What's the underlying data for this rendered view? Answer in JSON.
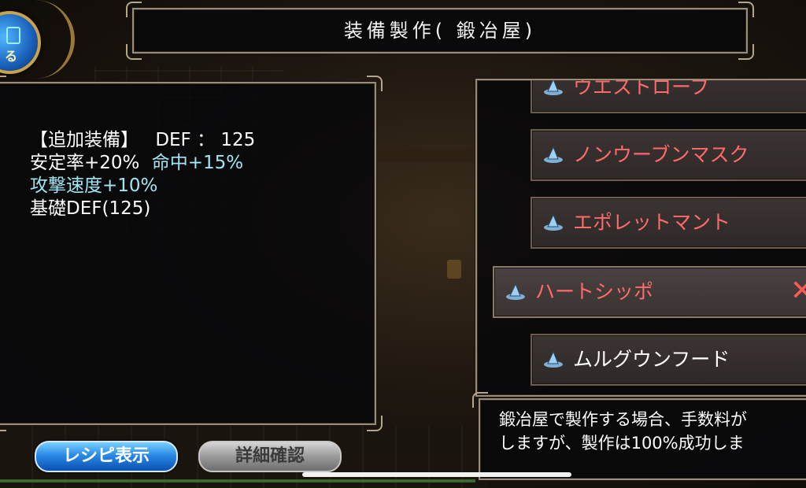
{
  "header": {
    "title": "装備製作( 鍛冶屋)"
  },
  "corner_button": {
    "label": "る"
  },
  "stats": {
    "line1_label": "【追加装備】",
    "line1_value": "DEF ： 125",
    "line2_a": "安定率+20%",
    "line2_b": "命中+15%",
    "line3": "攻撃速度+10%",
    "line4": "基礎DEF(125)"
  },
  "items": [
    {
      "label": "ウエストローブ"
    },
    {
      "label": "ノンウーブンマスク"
    },
    {
      "label": "エポレットマント"
    },
    {
      "label": "ハートシッポ",
      "close": "✕"
    },
    {
      "label": "ムルグウンフード"
    }
  ],
  "description": {
    "line1": "鍛冶屋で製作する場合、手数料が",
    "line2": "しますが、製作は100%成功しま"
  },
  "buttons": {
    "recipe": "レシピ表示",
    "detail": "詳細確認"
  },
  "colors": {
    "item_text": "#ff6b6b",
    "highlight_text": "#9fe6f5",
    "recipe_button": "#2a8ae6"
  }
}
